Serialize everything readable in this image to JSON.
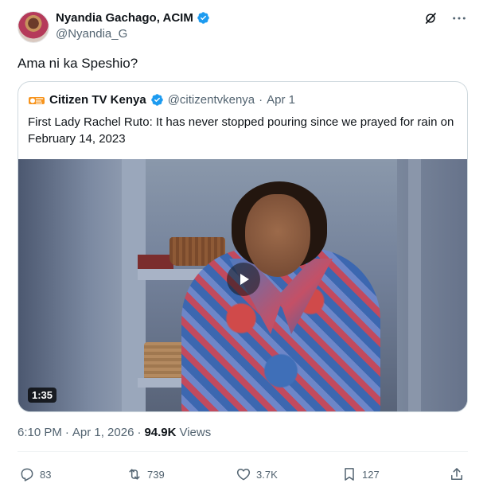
{
  "author": {
    "name": "Nyandia Gachago, ACIM",
    "handle": "@Nyandia_G"
  },
  "tweet": {
    "text": "Ama ni ka Speshio?",
    "time": "6:10 PM",
    "date": "Apr 1, 2026",
    "views_count": "94.9K",
    "views_label": "Views"
  },
  "quoted": {
    "name": "Citizen TV Kenya",
    "handle": "@citizentvkenya",
    "separator": "·",
    "date": "Apr 1",
    "text": "First Lady Rachel Ruto: It has never stopped pouring since we prayed for rain on February 14, 2023",
    "video_duration": "1:35"
  },
  "actions": {
    "replies": "83",
    "reposts": "739",
    "likes": "3.7K",
    "bookmarks": "127"
  },
  "colors": {
    "verified": "#1d9bf0",
    "secondary_text": "#536471",
    "primary_text": "#0f1419",
    "border": "#cfd9de"
  },
  "icons": [
    "grok-icon",
    "more-icon",
    "verified-icon",
    "play-icon",
    "reply-icon",
    "repost-icon",
    "like-icon",
    "bookmark-icon",
    "share-icon"
  ]
}
